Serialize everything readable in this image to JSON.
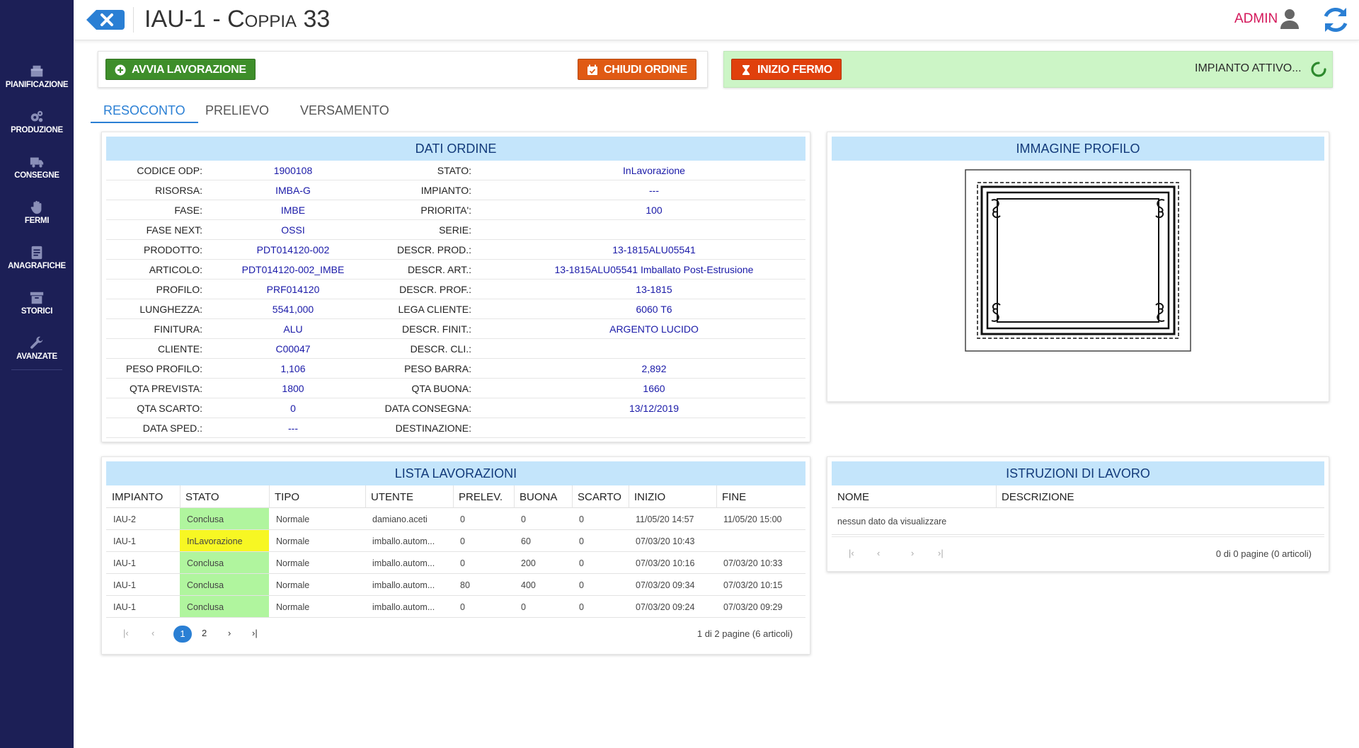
{
  "sidebar": {
    "items": [
      {
        "label": "PIANIFICAZIONE",
        "icon": "boxes-icon"
      },
      {
        "label": "PRODUZIONE",
        "icon": "gears-icon"
      },
      {
        "label": "CONSEGNE",
        "icon": "truck-icon"
      },
      {
        "label": "FERMI",
        "icon": "hand-icon"
      },
      {
        "label": "ANAGRAFICHE",
        "icon": "address-book-icon"
      },
      {
        "label": "STORICI",
        "icon": "archive-icon"
      },
      {
        "label": "AVANZATE",
        "icon": "wrench-icon"
      }
    ]
  },
  "header": {
    "title_main": "IAU-1 - ",
    "title_sc": "Coppia 33",
    "user": "ADMIN"
  },
  "actions": {
    "avvia": "AVVIA LAVORAZIONE",
    "chiudi": "CHIUDI ORDINE",
    "fermo": "INIZIO FERMO",
    "status": "IMPIANTO ATTIVO..."
  },
  "tabs": [
    "RESOCONTO",
    "PRELIEVO",
    "VERSAMENTO"
  ],
  "dati_ordine": {
    "title": "DATI ORDINE",
    "rows": [
      {
        "l1": "CODICE ODP:",
        "v1": "1900108",
        "l2": "STATO:",
        "v2": "InLavorazione"
      },
      {
        "l1": "RISORSA:",
        "v1": "IMBA-G",
        "l2": "IMPIANTO:",
        "v2": "---"
      },
      {
        "l1": "FASE:",
        "v1": "IMBE",
        "l2": "PRIORITA':",
        "v2": "100"
      },
      {
        "l1": "FASE NEXT:",
        "v1": "OSSI",
        "l2": "SERIE:",
        "v2": ""
      },
      {
        "l1": "PRODOTTO:",
        "v1": "PDT014120-002",
        "l2": "DESCR. PROD.:",
        "v2": "13-1815ALU05541"
      },
      {
        "l1": "ARTICOLO:",
        "v1": "PDT014120-002_IMBE",
        "l2": "DESCR. ART.:",
        "v2": "13-1815ALU05541 Imballato Post-Estrusione"
      },
      {
        "l1": "PROFILO:",
        "v1": "PRF014120",
        "l2": "DESCR. PROF.:",
        "v2": "13-1815"
      },
      {
        "l1": "LUNGHEZZA:",
        "v1": "5541,000",
        "l2": "LEGA CLIENTE:",
        "v2": "6060 T6"
      },
      {
        "l1": "FINITURA:",
        "v1": "ALU",
        "l2": "DESCR. FINIT.:",
        "v2": "ARGENTO LUCIDO"
      },
      {
        "l1": "CLIENTE:",
        "v1": "C00047",
        "l2": "DESCR. CLI.:",
        "v2": ""
      },
      {
        "l1": "PESO PROFILO:",
        "v1": "1,106",
        "l2": "PESO BARRA:",
        "v2": "2,892"
      },
      {
        "l1": "QTA PREVISTA:",
        "v1": "1800",
        "l2": "QTA BUONA:",
        "v2": "1660"
      },
      {
        "l1": "QTA SCARTO:",
        "v1": "0",
        "l2": "DATA CONSEGNA:",
        "v2": "13/12/2019"
      },
      {
        "l1": "DATA SPED.:",
        "v1": "---",
        "l2": "DESTINAZIONE:",
        "v2": ""
      }
    ]
  },
  "immagine_profilo": {
    "title": "IMMAGINE PROFILO"
  },
  "lista_lavorazioni": {
    "title": "LISTA LAVORAZIONI",
    "columns": [
      "IMPIANTO",
      "STATO",
      "TIPO",
      "UTENTE",
      "PRELEV.",
      "BUONA",
      "SCARTO",
      "INIZIO",
      "FINE"
    ],
    "rows": [
      {
        "impianto": "IAU-2",
        "stato": "Conclusa",
        "tipo": "Normale",
        "utente": "damiano.aceti",
        "prelev": "0",
        "buona": "0",
        "scarto": "0",
        "inizio": "11/05/20 14:57",
        "fine": "11/05/20 15:00"
      },
      {
        "impianto": "IAU-1",
        "stato": "InLavorazione",
        "tipo": "Normale",
        "utente": "imballo.autom...",
        "prelev": "0",
        "buona": "60",
        "scarto": "0",
        "inizio": "07/03/20 10:43",
        "fine": ""
      },
      {
        "impianto": "IAU-1",
        "stato": "Conclusa",
        "tipo": "Normale",
        "utente": "imballo.autom...",
        "prelev": "0",
        "buona": "200",
        "scarto": "0",
        "inizio": "07/03/20 10:16",
        "fine": "07/03/20 10:33"
      },
      {
        "impianto": "IAU-1",
        "stato": "Conclusa",
        "tipo": "Normale",
        "utente": "imballo.autom...",
        "prelev": "80",
        "buona": "400",
        "scarto": "0",
        "inizio": "07/03/20 09:34",
        "fine": "07/03/20 10:15"
      },
      {
        "impianto": "IAU-1",
        "stato": "Conclusa",
        "tipo": "Normale",
        "utente": "imballo.autom...",
        "prelev": "0",
        "buona": "0",
        "scarto": "0",
        "inizio": "07/03/20 09:24",
        "fine": "07/03/20 09:29"
      }
    ],
    "pager": {
      "current": "1",
      "next": "2",
      "info": "1 di 2 pagine (6 articoli)"
    }
  },
  "istruzioni": {
    "title": "ISTRUZIONI DI LAVORO",
    "columns": [
      "NOME",
      "DESCRIZIONE"
    ],
    "empty": "nessun dato da visualizzare",
    "pager_info": "0 di 0 pagine (0 articoli)"
  },
  "colors": {
    "sidebar": "#1c1f56",
    "accent": "#2a7fd4",
    "admin": "#d4185b",
    "conclusa": "#b0f59e",
    "inlavorazione": "#f7f723",
    "status_bg": "#ccf5c6"
  }
}
